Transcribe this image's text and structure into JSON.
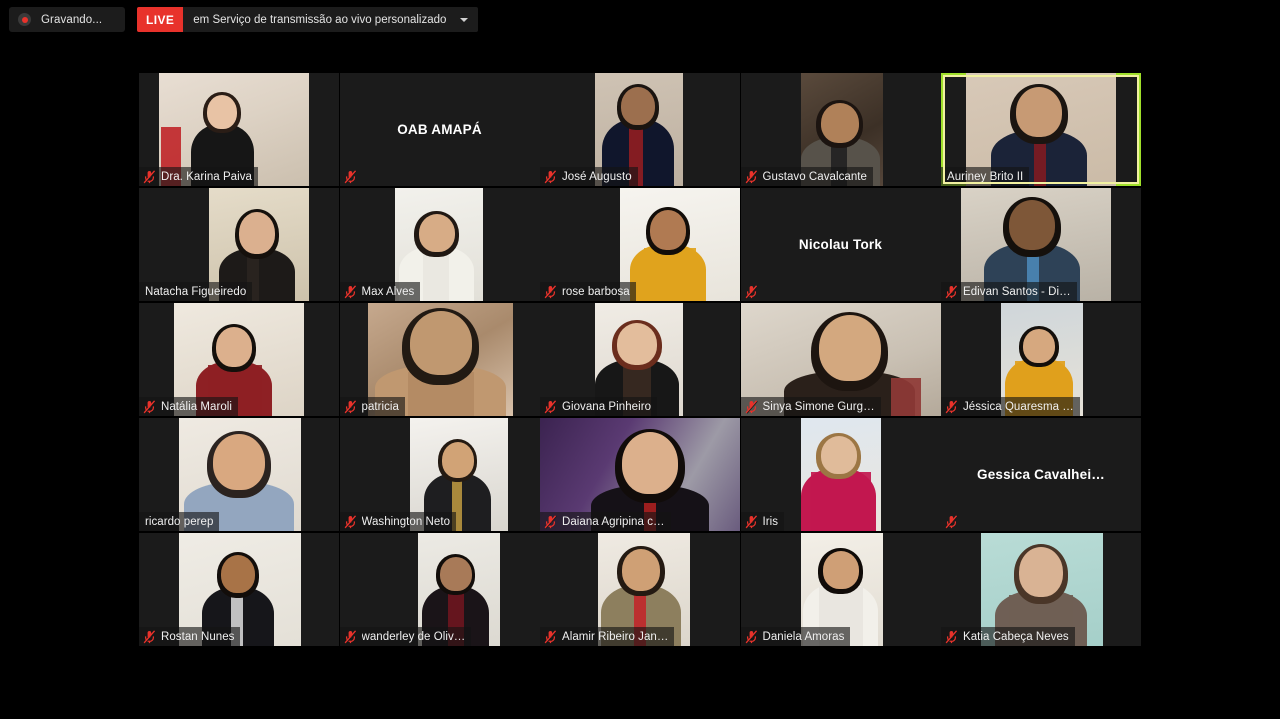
{
  "topbar": {
    "recording_label": "Gravando...",
    "recording_icon": "record-dot-icon",
    "live_badge": "LIVE",
    "live_text": "em Serviço de transmissão ao vivo personalizado",
    "caret_icon": "chevron-down-icon"
  },
  "gallery": {
    "columns": 5,
    "rows": 5,
    "active_speaker_border_color": "#9fe02a",
    "mic_muted_icon": "microphone-muted-icon",
    "tiles": [
      {
        "name": "Dra. Karina Paiva",
        "camera_on": true,
        "muted": true,
        "active": false
      },
      {
        "name": "OAB AMAPÁ",
        "camera_on": false,
        "muted": true,
        "active": false
      },
      {
        "name": "José Augusto",
        "camera_on": true,
        "muted": true,
        "active": false
      },
      {
        "name": "Gustavo Cavalcante",
        "camera_on": true,
        "muted": true,
        "active": false
      },
      {
        "name": "Auriney Brito II",
        "camera_on": true,
        "muted": false,
        "active": true
      },
      {
        "name": "Natacha Figueiredo",
        "camera_on": true,
        "muted": false,
        "active": false
      },
      {
        "name": "Max Alves",
        "camera_on": true,
        "muted": true,
        "active": false
      },
      {
        "name": "rose barbosa",
        "camera_on": true,
        "muted": true,
        "active": false
      },
      {
        "name": "Nicolau Tork",
        "camera_on": false,
        "muted": true,
        "active": false
      },
      {
        "name": "Edivan Santos - Di…",
        "camera_on": true,
        "muted": true,
        "active": false
      },
      {
        "name": "Natália Maroli",
        "camera_on": true,
        "muted": true,
        "active": false
      },
      {
        "name": "patricia",
        "camera_on": true,
        "muted": true,
        "active": false
      },
      {
        "name": "Giovana Pinheiro",
        "camera_on": true,
        "muted": true,
        "active": false
      },
      {
        "name": "Sinya Simone Gurg…",
        "camera_on": true,
        "muted": true,
        "active": false
      },
      {
        "name": "Jéssica Quaresma …",
        "camera_on": true,
        "muted": true,
        "active": false
      },
      {
        "name": "ricardo perep",
        "camera_on": true,
        "muted": false,
        "active": false
      },
      {
        "name": "Washington Neto",
        "camera_on": true,
        "muted": true,
        "active": false
      },
      {
        "name": "Daiana Agripina c…",
        "camera_on": true,
        "muted": true,
        "active": false
      },
      {
        "name": "Iris",
        "camera_on": true,
        "muted": true,
        "active": false
      },
      {
        "name": "Gessica  Cavalhei…",
        "camera_on": false,
        "muted": true,
        "active": false
      },
      {
        "name": "Rostan Nunes",
        "camera_on": true,
        "muted": true,
        "active": false
      },
      {
        "name": "wanderley de Oliv…",
        "camera_on": true,
        "muted": true,
        "active": false
      },
      {
        "name": "Alamir Ribeiro Jan…",
        "camera_on": true,
        "muted": true,
        "active": false
      },
      {
        "name": "Daniela Amoras",
        "camera_on": true,
        "muted": true,
        "active": false
      },
      {
        "name": "Katia Cabeça Neves",
        "camera_on": true,
        "muted": true,
        "active": false
      }
    ]
  }
}
